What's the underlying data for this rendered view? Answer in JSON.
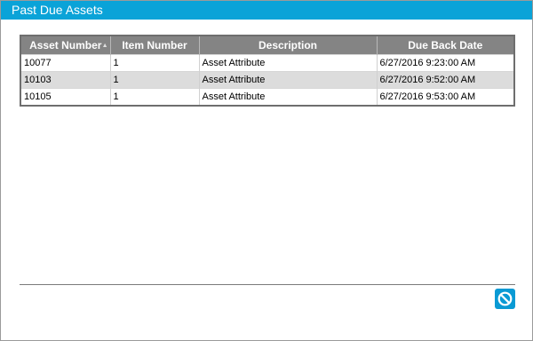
{
  "window": {
    "title": "Past Due Assets"
  },
  "table": {
    "columns": [
      "Asset Number",
      "Item Number",
      "Description",
      "Due Back Date"
    ],
    "rows": [
      [
        "10077",
        "1",
        "Asset Attribute",
        "6/27/2016 9:23:00 AM"
      ],
      [
        "10103",
        "1",
        "Asset Attribute",
        "6/27/2016 9:52:00 AM"
      ],
      [
        "10105",
        "1",
        "Asset Attribute",
        "6/27/2016 9:53:00 AM"
      ]
    ],
    "sort_indicator": "▲"
  },
  "footer": {
    "cancel_icon": "cancel-icon"
  },
  "colors": {
    "titlebar": "#0aa3d8",
    "header": "#848484",
    "alt_row": "#dcdcdc",
    "button": "#0a9ad4"
  }
}
